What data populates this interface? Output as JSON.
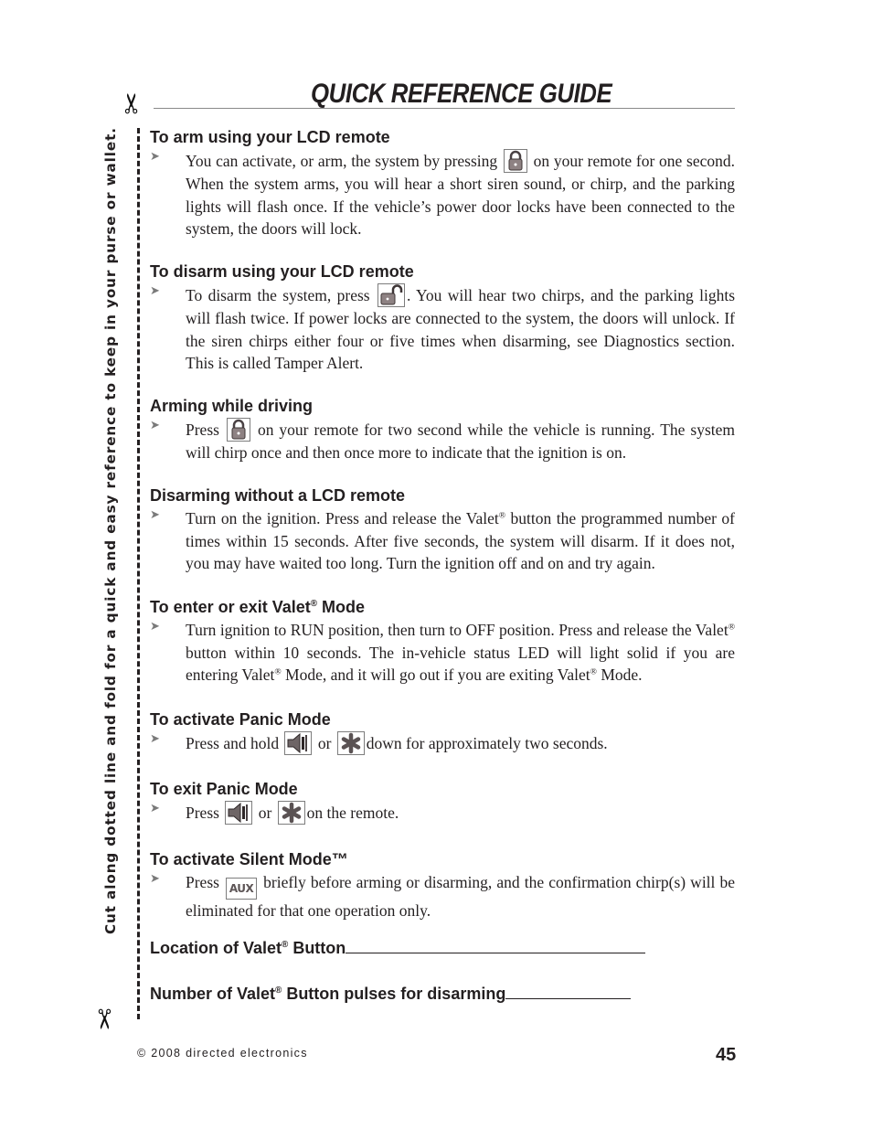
{
  "page": {
    "title": "QUICK REFERENCE GUIDE",
    "cut_instruction": "Cut along dotted line and fold for a quick and easy reference to keep in your purse or wallet.",
    "footer": "© 2008 directed electronics",
    "page_number": "45"
  },
  "icons": {
    "scissors_top": "scissors-icon",
    "scissors_bottom": "scissors-icon",
    "bullet": "arrowhead-bullet-icon",
    "lock": "lock-button-icon",
    "unlock": "unlock-button-icon",
    "speaker": "siren-speaker-button-icon",
    "star": "aux-star-button-icon",
    "aux": "aux-button-icon",
    "aux_label": "AUX"
  },
  "sections": [
    {
      "heading": "To arm using your LCD remote",
      "parts": [
        "You can activate, or arm, the system by pressing",
        " on your remote for one second. When the system arms, you will hear a short siren sound, or chirp, and the parking lights will flash once. If the vehicle’s power door locks have been connected to the system, the doors will lock."
      ]
    },
    {
      "heading": "To disarm using your LCD remote",
      "parts": [
        "To disarm the system, press",
        ". You will hear two chirps, and the parking lights will flash twice. If power locks are connected to the system, the doors will unlock. If the siren chirps either four or five times when disarming, see Diagnostics section. This is called Tamper Alert."
      ]
    },
    {
      "heading": "Arming while driving",
      "parts": [
        "Press",
        " on your remote for two second while the vehicle is running. The system will chirp once and then once more to indicate that the ignition is on."
      ]
    },
    {
      "heading": "Disarming without a LCD remote",
      "parts": [
        "Turn on the ignition. Press and release the Valet",
        "®",
        " button the programmed number of times within 15 seconds. After five seconds, the system will disarm. If it does not, you may have waited too long. Turn the ignition off and on and try again."
      ]
    },
    {
      "heading_parts": [
        "To enter or exit Valet",
        "®",
        " Mode"
      ],
      "parts": [
        "Turn ignition to RUN position, then turn to OFF position. Press and release the Valet",
        "®",
        " button within 10 seconds. The in-vehicle status LED will light solid if you are entering Valet",
        "®",
        " Mode, and it will go out if you are exiting Valet",
        "®",
        " Mode."
      ]
    },
    {
      "heading": "To activate Panic Mode",
      "parts": [
        "Press and hold",
        "or",
        "down for approximately two seconds."
      ]
    },
    {
      "heading": "To exit Panic Mode",
      "parts": [
        "Press",
        "or",
        "on the remote."
      ]
    },
    {
      "heading": "To activate Silent Mode™",
      "parts": [
        "Press",
        " briefly before arming or disarming, and the confirmation chirp(s) will be eliminated for that one operation only."
      ]
    }
  ],
  "fill_in": [
    {
      "label_parts": [
        "Location of Valet",
        "®",
        " Button"
      ],
      "value": ""
    },
    {
      "label_parts": [
        "Number of Valet",
        "®",
        " Button pulses for disarming"
      ],
      "value": ""
    }
  ]
}
